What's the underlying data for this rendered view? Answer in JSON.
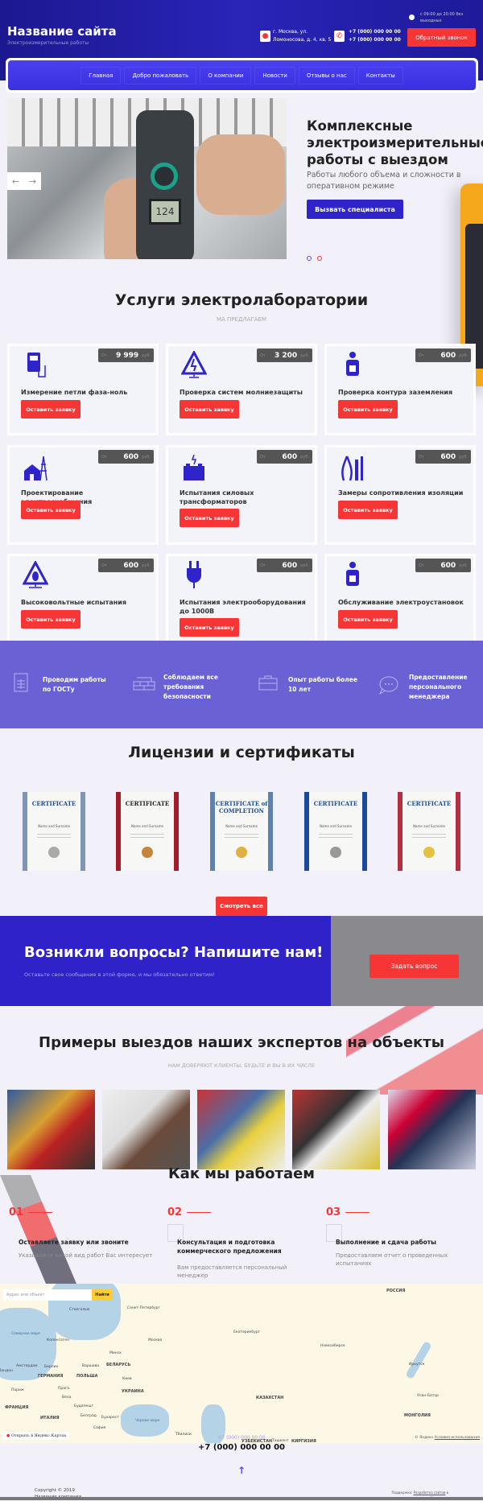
{
  "header": {
    "site_name": "Название сайта",
    "tagline": "Электроизмерительные работы",
    "address": [
      "г. Москва, ул.",
      "Ломоносова, д. 4, кв. 5"
    ],
    "phones": [
      "+7 (000) 000 00 00",
      "+7 (000) 000 00 00"
    ],
    "hours": [
      "с 09:00 до 20:00 без",
      "выходных"
    ],
    "callback_button": "Обратный звонок"
  },
  "nav": [
    "Главная",
    "Добро пожаловать",
    "О компании",
    "Новости",
    "Отзывы о нас",
    "Контакты"
  ],
  "hero": {
    "title": "Комплексные электроизмерительные работы с выездом",
    "subtitle": "Работы любого объема и сложности в оперативном режиме",
    "button": "Вызвать специалиста",
    "meter_reading": "124",
    "slide": 1,
    "slides": 2
  },
  "services": {
    "title": "Услуги электролаборатории",
    "subtitle": "Ма предлагаем",
    "from": "От",
    "currency": "руб.",
    "button": "Оставить заявку",
    "items": [
      {
        "title": "Измерение петли фаза-ноль",
        "price": "9 999",
        "icon": "multimeter-icon"
      },
      {
        "title": "Проверка систем молниезащиты",
        "price": "3 200",
        "icon": "lightning-warning-icon"
      },
      {
        "title": "Проверка контура заземления",
        "price": "600",
        "icon": "electrician-icon"
      },
      {
        "title": "Проектирование электроснабжения",
        "price": "600",
        "icon": "house-tower-icon"
      },
      {
        "title": "Испытания силовых трансформаторов",
        "price": "600",
        "icon": "battery-icon"
      },
      {
        "title": "Замеры сопротивления изоляции",
        "price": "600",
        "icon": "tools-icon"
      },
      {
        "title": "Высоковольтные испытания",
        "price": "600",
        "icon": "high-voltage-icon"
      },
      {
        "title": "Испытания электрооборудования до 1000В",
        "price": "600",
        "icon": "plug-icon"
      },
      {
        "title": "Обслуживание электроустановок",
        "price": "600",
        "icon": "electrician-icon"
      }
    ]
  },
  "features": [
    {
      "text": "Проводим работы по ГОСТу",
      "icon": "document-icon"
    },
    {
      "text": "Соблюдаем все требования безопасности",
      "icon": "bricks-icon"
    },
    {
      "text": "Опыт работы более 10 лет",
      "icon": "briefcase-icon"
    },
    {
      "text": "Предоставление персонального менеджера",
      "icon": "chat-icon"
    }
  ],
  "certificates": {
    "title": "Лицензии и сертификаты",
    "button": "Смотреть все",
    "items": [
      {
        "heading": "CERTIFICATE",
        "name": "Name and Surname",
        "color": "#7f95b5"
      },
      {
        "heading": "CERTIFICATE",
        "name": "Name and Surname",
        "color": "#a51c27"
      },
      {
        "heading": "CERTIFICATE of COMPLETION",
        "name": "Name and Surname",
        "color": "#5d82ad"
      },
      {
        "heading": "CERTIFICATE",
        "name": "Name and Surname",
        "color": "#1b4a9c"
      },
      {
        "heading": "CERTIFICATE",
        "name": "Name and Surname",
        "color": "#b43040"
      }
    ]
  },
  "cta": {
    "title": "Возникли вопросы? Напишите нам!",
    "subtitle": "Оставьте свое сообщение в этой форме, и мы обязательно ответим!",
    "button": "Задать вопрос"
  },
  "examples": {
    "title": "Примеры выездов наших экспертов на объекты",
    "subtitle": "Нам доверяют клиенты, будьте и вы в их числе"
  },
  "how": {
    "title": "Как мы работаем",
    "steps": [
      {
        "num": "01",
        "title": "Оставляете заявку или звоните",
        "desc": "Указываете какой вид работ Вас интересует"
      },
      {
        "num": "02",
        "title": "Консультация и подготовка коммерческого предложения",
        "desc": "Вам предоставляется персональный менеджер"
      },
      {
        "num": "03",
        "title": "Выполнение и сдача работы",
        "desc": "Предоставляем отчет о проведенных испытаниях"
      }
    ]
  },
  "map": {
    "search_placeholder": "Адрес или объект",
    "search_button": "Найти",
    "open_link": "Открыть в Яндекс.Картах",
    "copyright": "© Яндекс",
    "terms": "Условия использования",
    "labels": [
      "РОССИЯ",
      "Санкт-Петербург",
      "Стокгольм",
      "Северное море",
      "Копенгаген",
      "Москва",
      "Екатеринбург",
      "Новосибирск",
      "Минск",
      "БЕЛАРУСЬ",
      "Амстердам",
      "Берлин",
      "Варшава",
      "Лондон",
      "ГЕРМАНИЯ",
      "ПОЛЬША",
      "Киев",
      "Прага",
      "УКРАИНА",
      "Париж",
      "Вена",
      "Будапешт",
      "ФРАНЦИЯ",
      "КАЗАХСТАН",
      "Иркутск",
      "Улан-Батор",
      "МОНГОЛИЯ",
      "ИТАЛИЯ",
      "Белград",
      "Бухарест",
      "Черное море",
      "София",
      "Тбилиси",
      "УЗБЕКИСТАН",
      "Ташкент",
      "КИРГИЗИЯ"
    ]
  },
  "footer": {
    "phone_small": "+7 (000) 000 00 00",
    "phone_big": "+7 (000) 000 00 00",
    "copyright": "Copyright © 2019",
    "company": "Название компании",
    "support_prefix": "Поддержка:",
    "support_link": "Разработка сайтов",
    "support_suffix": "в Megagroup"
  },
  "colors": {
    "primary": "#2f24c9",
    "accent": "#f63535",
    "band": "#6a62d4",
    "header": "#1e1a9a"
  }
}
